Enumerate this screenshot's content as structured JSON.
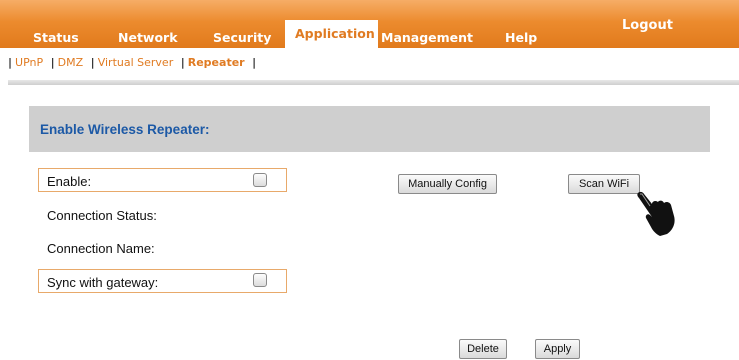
{
  "nav": {
    "tabs": [
      {
        "label": "Status"
      },
      {
        "label": "Network"
      },
      {
        "label": "Security"
      },
      {
        "label": "Application"
      },
      {
        "label": "Management"
      },
      {
        "label": "Help"
      }
    ],
    "logout": "Logout",
    "active_tab": "Application",
    "accent_color": "#e8852a"
  },
  "subnav": {
    "items": [
      "UPnP",
      "DMZ",
      "Virtual Server",
      "Repeater"
    ],
    "separator": "|",
    "active": "Repeater"
  },
  "panel": {
    "title": "Enable Wireless Repeater:",
    "title_color": "#1c59a6"
  },
  "form": {
    "enable_label": "Enable:",
    "enable_checked": false,
    "connection_status_label": "Connection Status:",
    "connection_name_label": "Connection Name:",
    "sync_label": "Sync with gateway:",
    "sync_checked": false
  },
  "buttons": {
    "manual": "Manually Config",
    "scan": "Scan WiFi",
    "delete": "Delete",
    "apply": "Apply"
  },
  "icons": {
    "pointer": "hand-pointer-icon"
  }
}
